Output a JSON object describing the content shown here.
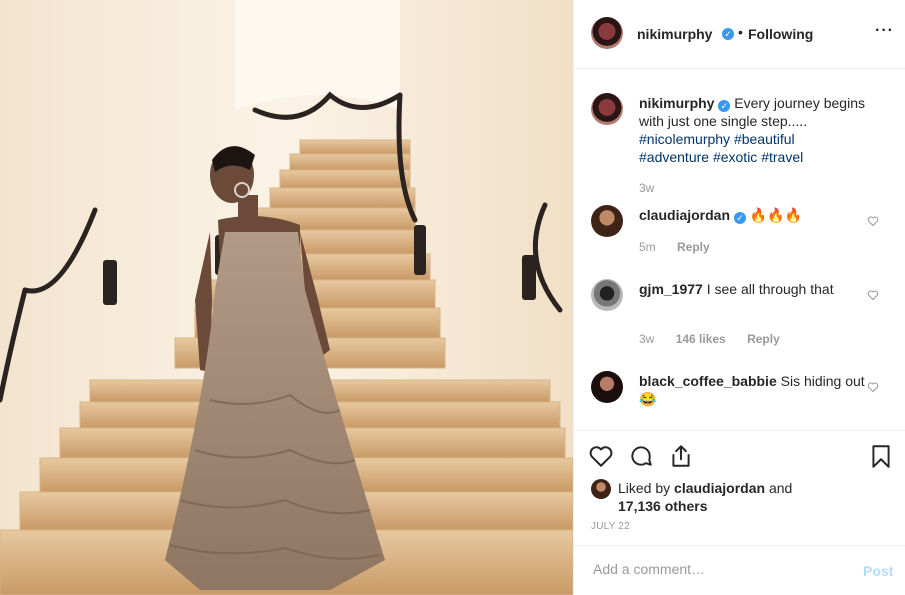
{
  "header": {
    "username": "nikimurphy",
    "dot": "•",
    "follow_status": "Following",
    "more": "···"
  },
  "caption": {
    "username": "nikimurphy",
    "text": "Every journey begins with just one single step.....",
    "tags": [
      "#nicolemurphy",
      "#beautiful",
      "#adventure",
      "#exotic",
      "#travel"
    ],
    "time": "3w"
  },
  "comments": [
    {
      "username": "claudiajordan",
      "verified": true,
      "text": "🔥🔥🔥",
      "time": "5m",
      "likes": "",
      "reply": "Reply"
    },
    {
      "username": "gjm_1977",
      "verified": false,
      "text": "I see all through that",
      "time": "3w",
      "likes": "146 likes",
      "reply": "Reply"
    },
    {
      "username": "black_coffee_babbie",
      "verified": false,
      "text": "Sis hiding out😂",
      "time": "",
      "likes": "",
      "reply": ""
    }
  ],
  "likes": {
    "prefix": "Liked by",
    "user": "claudiajordan",
    "and": "and",
    "others": "17,136 others"
  },
  "date": "JULY 22",
  "add_comment": {
    "placeholder": "Add a comment…",
    "post_label": "Post"
  },
  "colors": {
    "verified": "#3897f0",
    "hashtag": "#003569",
    "muted": "#999999",
    "post_button": "#b3dbff"
  },
  "icons": [
    "heart-icon",
    "comment-icon",
    "share-icon",
    "bookmark-icon",
    "verified-badge-icon",
    "more-options-icon"
  ]
}
